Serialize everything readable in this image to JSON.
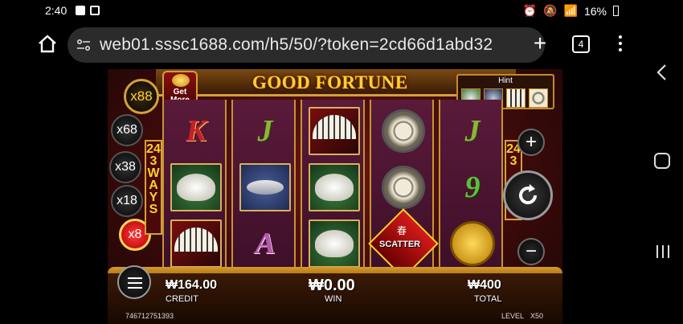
{
  "status": {
    "time": "2:40",
    "battery": "16%",
    "network": "Wi-Fi"
  },
  "browser": {
    "url": "web01.sssc1688.com/h5/50/?token=2cd66d1abd32",
    "tab_count": "4"
  },
  "game": {
    "title": "GOOD FORTUNE",
    "get_more": "Get More",
    "hint_label": "Hint",
    "ways_left": "243WAYS",
    "ways_right": "243",
    "multipliers": [
      "x88",
      "x68",
      "x38",
      "x18",
      "x8"
    ],
    "active_multiplier": "x8",
    "reels": [
      [
        "K",
        "ingot",
        "fan"
      ],
      [
        "J",
        "fish",
        "A"
      ],
      [
        "fan",
        "ingot",
        "ingot"
      ],
      [
        "medal",
        "medal",
        "scatter"
      ],
      [
        "J",
        "9",
        "coin"
      ]
    ],
    "scatter_text": "SCATTER",
    "scatter_char": "春",
    "credit": {
      "value": "₩164.00",
      "label": "CREDIT"
    },
    "win": {
      "value": "₩0.00",
      "label": "WIN"
    },
    "total": {
      "value": "₩400",
      "label": "TOTAL"
    },
    "game_id": "746712751393",
    "level_label": "LEVEL",
    "level_value": "X50"
  }
}
